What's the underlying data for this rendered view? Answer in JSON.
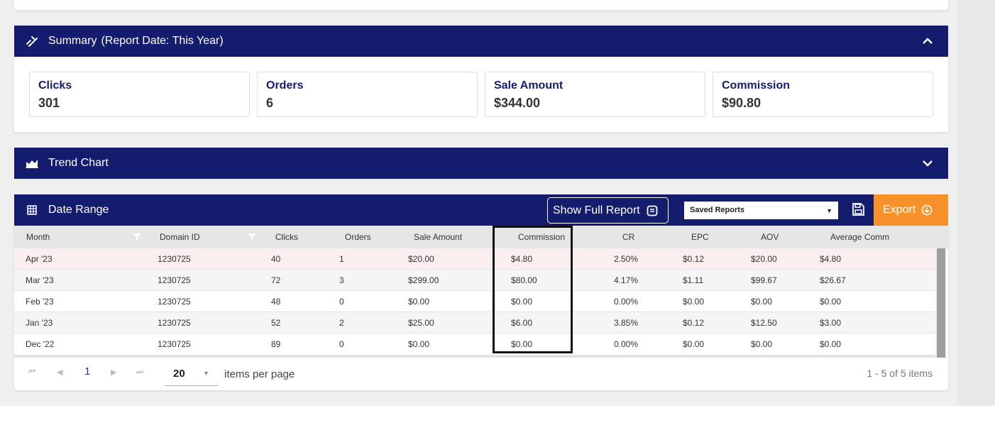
{
  "summary": {
    "title": "Summary",
    "report_date": "(Report Date: This Year)",
    "metrics": [
      {
        "label": "Clicks",
        "value": "301"
      },
      {
        "label": "Orders",
        "value": "6"
      },
      {
        "label": "Sale Amount",
        "value": "$344.00"
      },
      {
        "label": "Commission",
        "value": "$90.80"
      }
    ]
  },
  "trend": {
    "title": "Trend Chart"
  },
  "date_range": {
    "title": "Date Range",
    "show_full_report": "Show Full Report",
    "saved_reports": "Saved Reports",
    "export": "Export"
  },
  "table": {
    "columns": [
      "Month",
      "Domain ID",
      "Clicks",
      "Orders",
      "Sale Amount",
      "Commission",
      "CR",
      "EPC",
      "AOV",
      "Average Comm"
    ],
    "rows": [
      [
        "Apr '23",
        "1230725",
        "40",
        "1",
        "$20.00",
        "$4.80",
        "2.50%",
        "$0.12",
        "$20.00",
        "$4.80"
      ],
      [
        "Mar '23",
        "1230725",
        "72",
        "3",
        "$299.00",
        "$80.00",
        "4.17%",
        "$1.11",
        "$99.67",
        "$26.67"
      ],
      [
        "Feb '23",
        "1230725",
        "48",
        "0",
        "$0.00",
        "$0.00",
        "0.00%",
        "$0.00",
        "$0.00",
        "$0.00"
      ],
      [
        "Jan '23",
        "1230725",
        "52",
        "2",
        "$25.00",
        "$6.00",
        "3.85%",
        "$0.12",
        "$12.50",
        "$3.00"
      ],
      [
        "Dec '22",
        "1230725",
        "89",
        "0",
        "$0.00",
        "$0.00",
        "0.00%",
        "$0.00",
        "$0.00",
        "$0.00"
      ]
    ]
  },
  "pager": {
    "current_page": "1",
    "page_size": "20",
    "items_per_page": "items per page",
    "info": "1 - 5 of 5 items"
  },
  "colors": {
    "header_navy": "#141c6e",
    "export_orange": "#f7922b",
    "hover_row": "#fbeeee"
  }
}
